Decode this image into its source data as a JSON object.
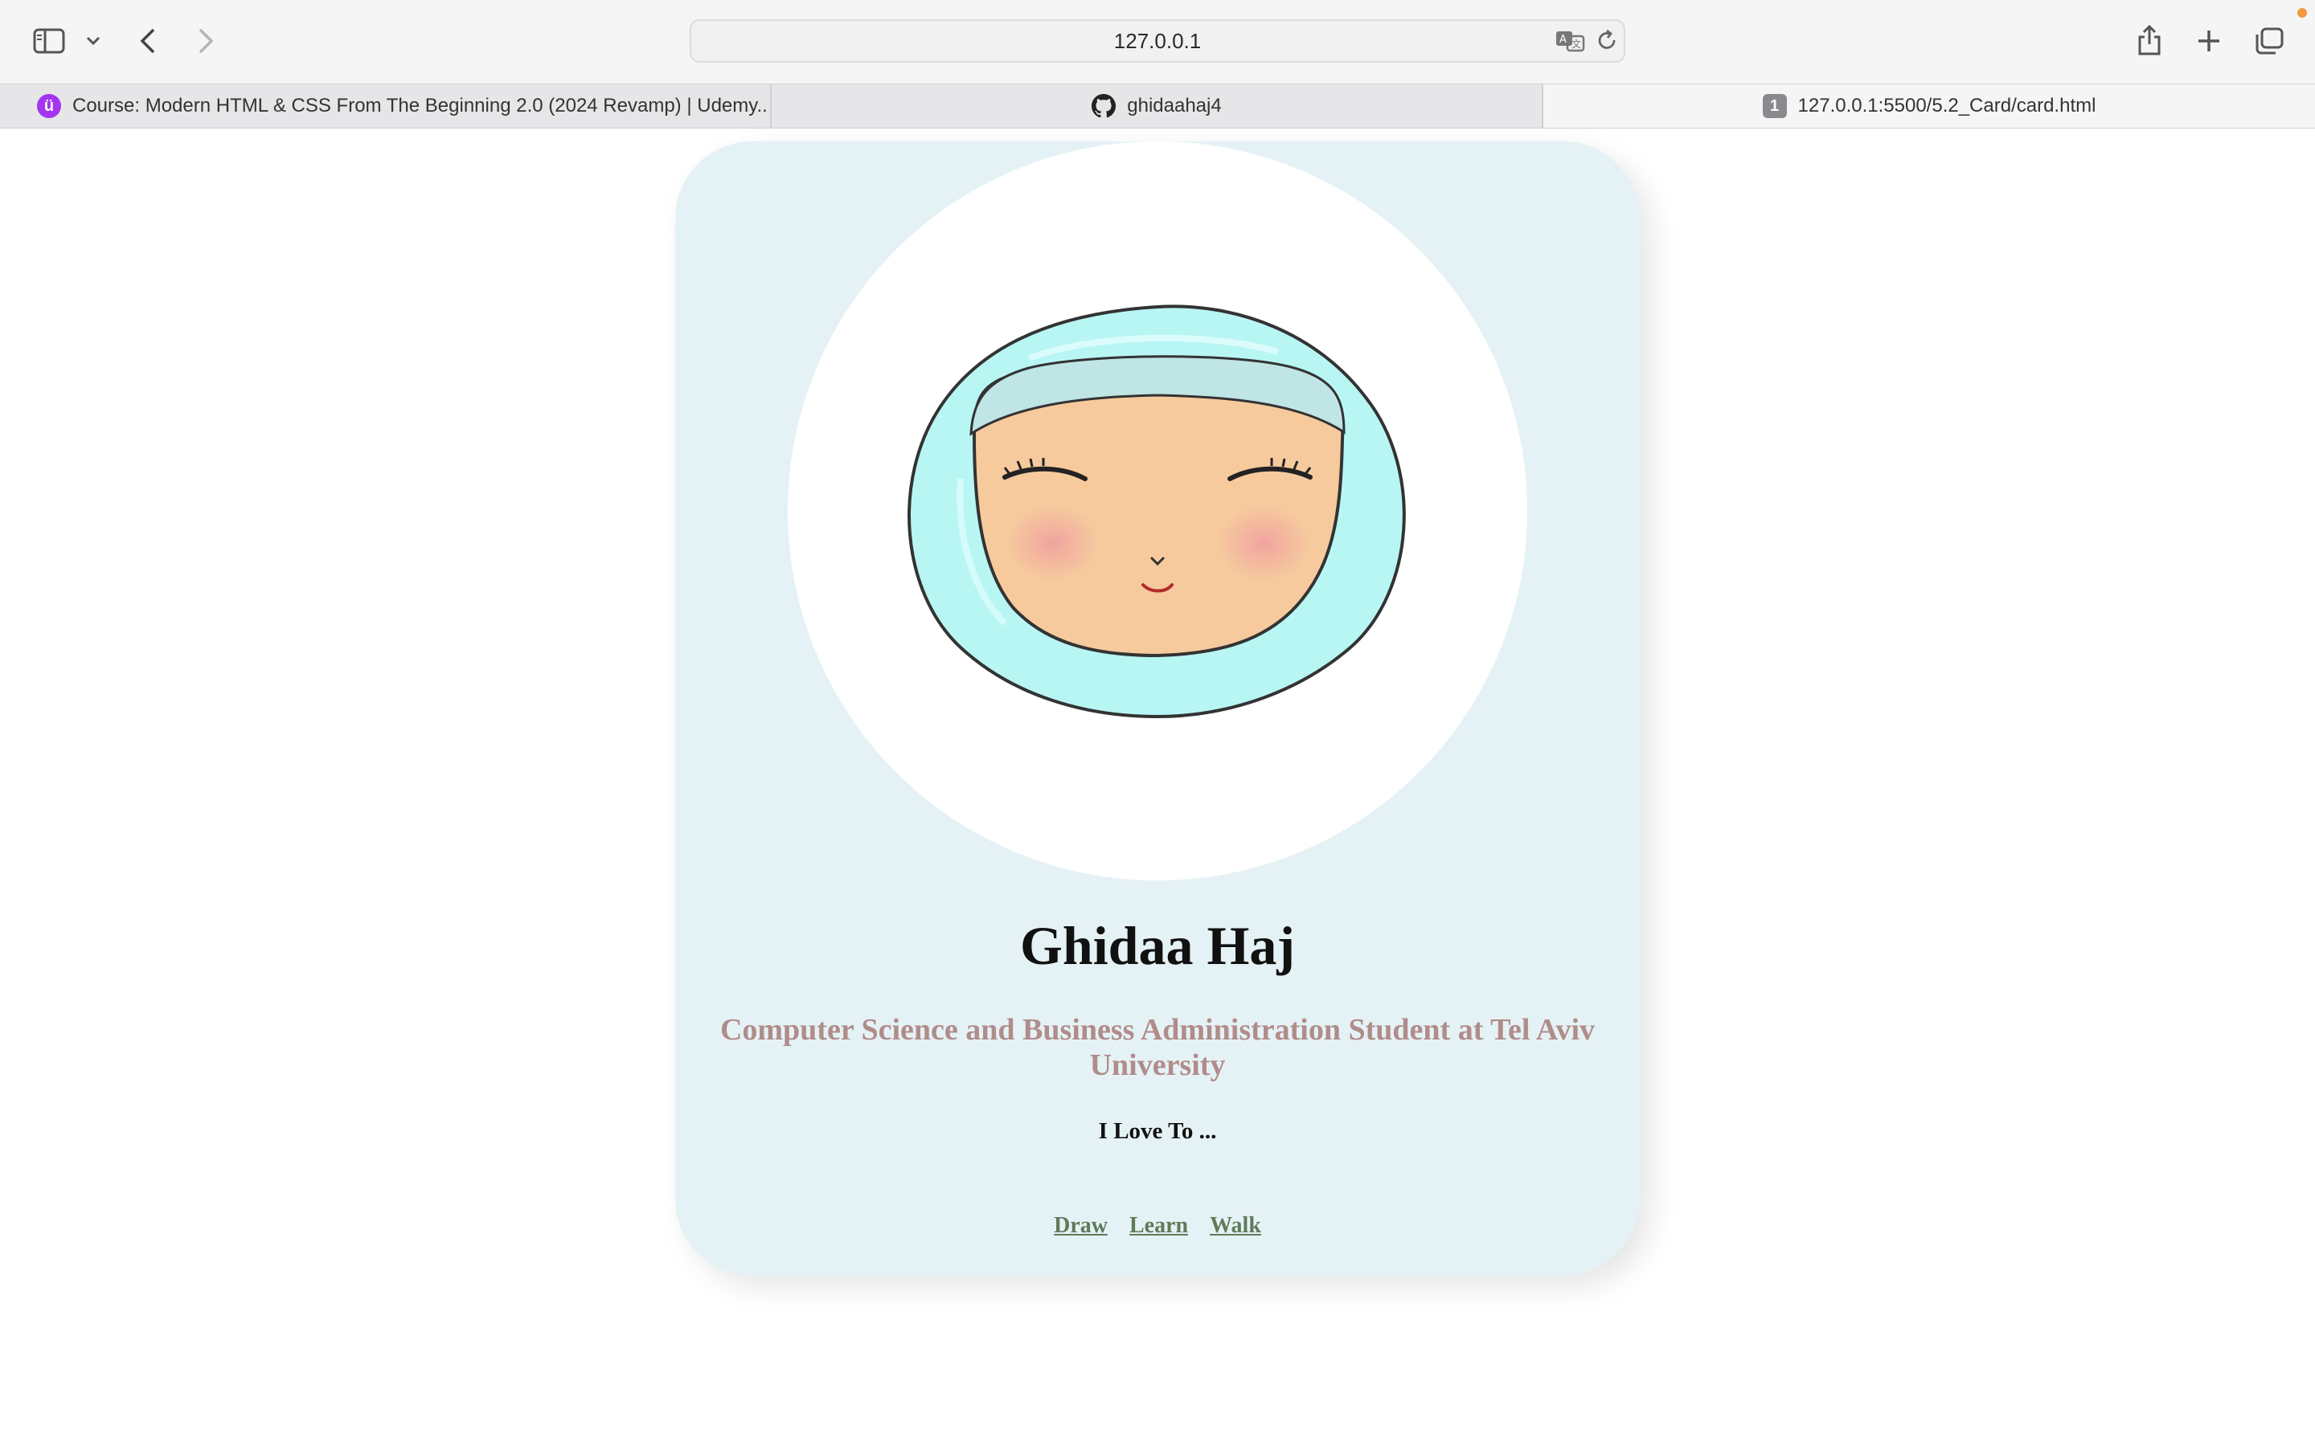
{
  "browser": {
    "address": "127.0.0.1",
    "tabs": [
      {
        "title": "Course: Modern HTML & CSS From The Beginning 2.0 (2024 Revamp) | Udemy...",
        "favicon": "udemy-icon",
        "favicon_color": "#a435f0"
      },
      {
        "title": "ghidaahaj4",
        "favicon": "github-icon"
      },
      {
        "title": "127.0.0.1:5500/5.2_Card/card.html",
        "favicon_text": "1",
        "active": true
      }
    ]
  },
  "card": {
    "name": "Ghidaa Haj",
    "subtitle": "Computer Science and Business Administration Student at Tel Aviv University",
    "love_heading": "I Love To ...",
    "links": [
      "Draw",
      "Learn",
      "Walk"
    ],
    "colors": {
      "card_bg": "#e5f2f5",
      "subtitle": "#b08c8a",
      "link": "#5f7b5a",
      "hijab": "#b8f6f4",
      "skin": "#f6ca9d",
      "blush": "#f0a8a6"
    }
  }
}
